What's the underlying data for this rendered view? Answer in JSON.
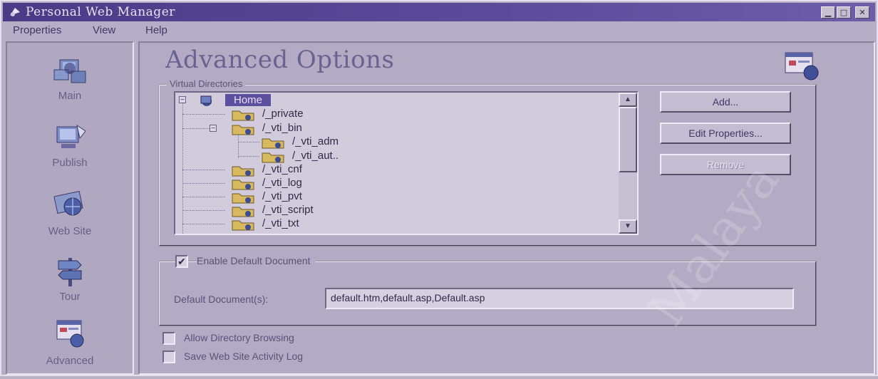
{
  "window": {
    "title": "Personal Web Manager",
    "controls": {
      "minimize": "▁",
      "maximize": "□",
      "close": "✕"
    }
  },
  "menu": [
    "Properties",
    "View",
    "Help"
  ],
  "nav": [
    {
      "label": "Main",
      "icon": "main-computers-icon"
    },
    {
      "label": "Publish",
      "icon": "publish-icon"
    },
    {
      "label": "Web Site",
      "icon": "web-site-icon"
    },
    {
      "label": "Tour",
      "icon": "tour-signpost-icon"
    },
    {
      "label": "Advanced",
      "icon": "advanced-icon"
    }
  ],
  "main": {
    "title": "Advanced Options",
    "virtual_directories": {
      "label": "Virtual Directories",
      "tree": [
        {
          "label": "Home",
          "level": 0,
          "selected": true
        },
        {
          "label": "/_private",
          "level": 1
        },
        {
          "label": "/_vti_bin",
          "level": 1
        },
        {
          "label": "/_vti_adm",
          "level": 2
        },
        {
          "label": "/_vti_aut..",
          "level": 2
        },
        {
          "label": "/_vti_cnf",
          "level": 1
        },
        {
          "label": "/_vti_log",
          "level": 1
        },
        {
          "label": "/_vti_pvt",
          "level": 1
        },
        {
          "label": "/_vti_script",
          "level": 1
        },
        {
          "label": "/_vti_txt",
          "level": 1
        }
      ],
      "buttons": {
        "add": "Add...",
        "edit": "Edit Properties...",
        "remove": "Remove"
      }
    },
    "default_document": {
      "checkbox_label": "Enable Default Document",
      "checked": true,
      "field_label": "Default Document(s):",
      "field_value": "default.htm,default.asp,Default.asp"
    },
    "allow_browsing": {
      "label": "Allow Directory Browsing",
      "checked": false
    },
    "save_log": {
      "label": "Save Web Site Activity Log",
      "checked": false
    }
  },
  "watermark": "Malaya"
}
